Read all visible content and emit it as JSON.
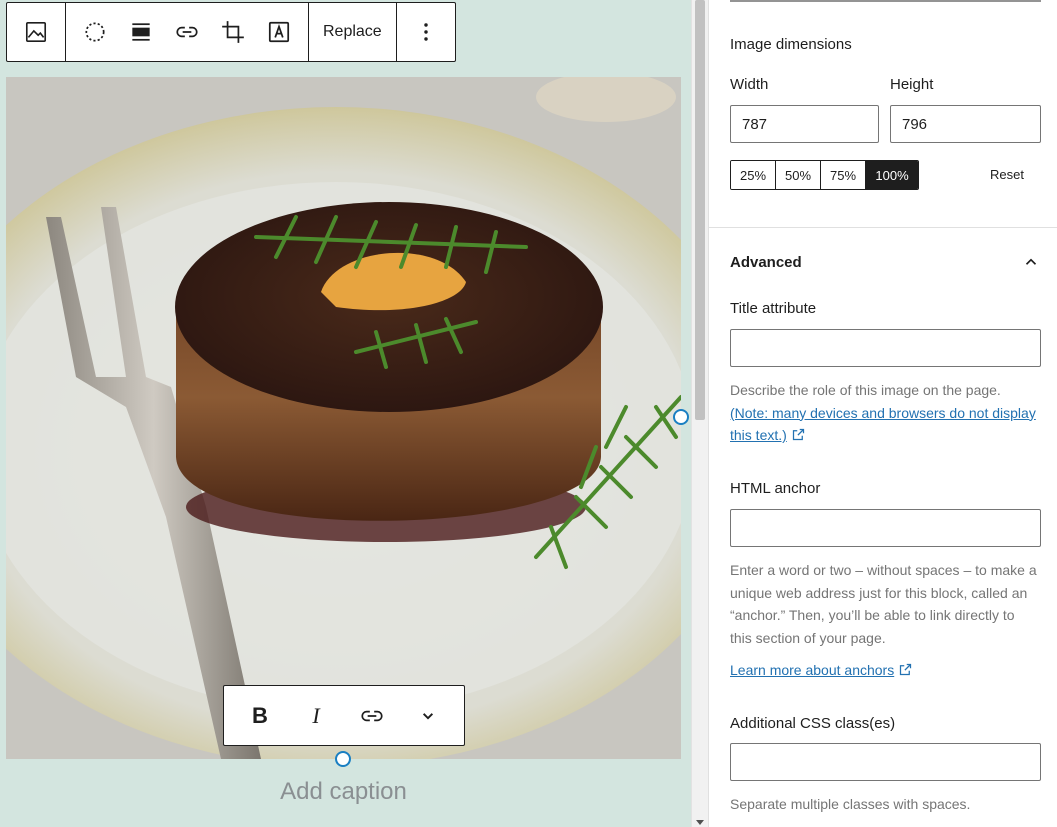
{
  "toolbar": {
    "replace_label": "Replace",
    "icons": [
      "image-icon",
      "duotone-icon",
      "align-icon",
      "link-icon",
      "crop-icon",
      "text-overlay-icon",
      "more-options-icon"
    ]
  },
  "format_toolbar": {
    "bold_label": "B",
    "italic_label": "I",
    "icons": [
      "bold-icon",
      "italic-icon",
      "link-icon",
      "chevron-down-icon"
    ]
  },
  "caption": {
    "placeholder": "Add caption"
  },
  "sidebar": {
    "dimensions": {
      "title": "Image dimensions",
      "width_label": "Width",
      "height_label": "Height",
      "width_value": "787",
      "height_value": "796",
      "scales": [
        "25%",
        "50%",
        "75%",
        "100%"
      ],
      "active_scale": "100%",
      "reset_label": "Reset"
    },
    "advanced": {
      "title": "Advanced",
      "title_attribute_label": "Title attribute",
      "title_attribute_value": "",
      "title_help": "Describe the role of this image on the page.",
      "title_help_link": "(Note: many devices and browsers do not display this text.)",
      "anchor_label": "HTML anchor",
      "anchor_value": "",
      "anchor_help": "Enter a word or two – without spaces – to make a unique web address just for this block, called an “anchor.” Then, you’ll be able to link directly to this section of your page.",
      "anchor_help_link": "Learn more about anchors",
      "css_label": "Additional CSS class(es)",
      "css_value": "",
      "css_help": "Separate multiple classes with spaces."
    }
  },
  "colors": {
    "canvas_bg": "#d3e5df",
    "accent": "#1a7fc2",
    "link": "#2271b1",
    "active_button": "#1e1e1e"
  }
}
